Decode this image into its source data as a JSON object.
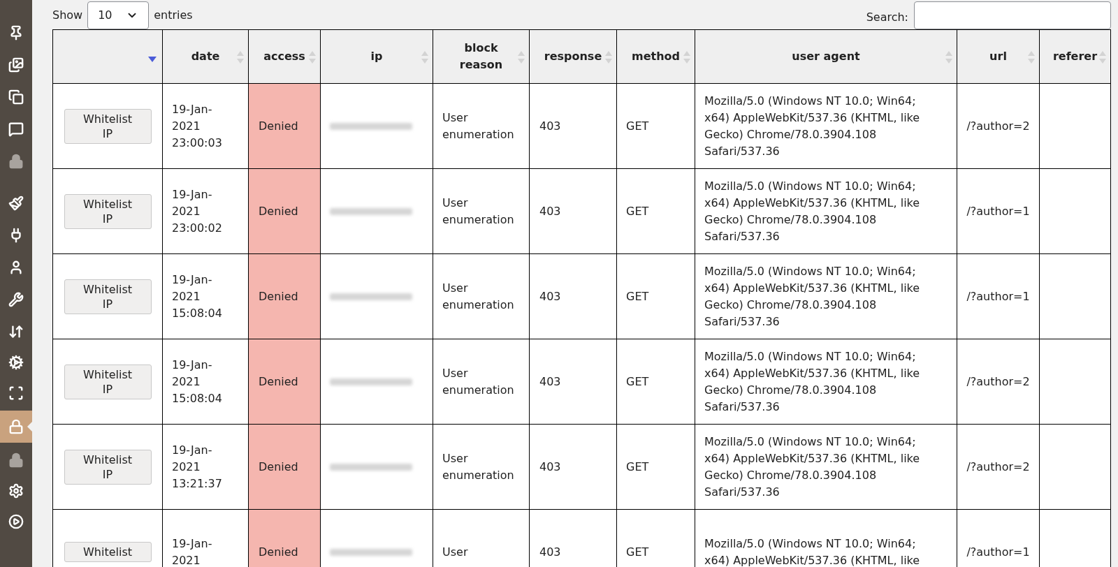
{
  "sidebar": {
    "items": [
      {
        "selected": false,
        "disabled": false
      },
      {
        "selected": false,
        "disabled": false
      },
      {
        "selected": false,
        "disabled": false
      },
      {
        "selected": false,
        "disabled": false
      },
      {
        "selected": false,
        "disabled": true
      },
      {
        "selected": false,
        "disabled": false
      },
      {
        "selected": false,
        "disabled": false
      },
      {
        "selected": false,
        "disabled": false
      },
      {
        "selected": false,
        "disabled": false
      },
      {
        "selected": false,
        "disabled": false
      },
      {
        "selected": false,
        "disabled": false
      },
      {
        "selected": false,
        "disabled": false
      },
      {
        "selected": true,
        "disabled": false
      },
      {
        "selected": false,
        "disabled": true
      },
      {
        "selected": false,
        "disabled": false
      },
      {
        "selected": false,
        "disabled": false
      }
    ]
  },
  "length_menu": {
    "prefix": "Show",
    "value": "10",
    "suffix": "entries"
  },
  "search": {
    "label": "Search:"
  },
  "table": {
    "columns": [
      {
        "sorted": true
      },
      {
        "label": "date",
        "sorted": false
      },
      {
        "label": "access",
        "sorted": false
      },
      {
        "label": "ip",
        "sorted": false
      },
      {
        "label": "block reason",
        "sorted": false
      },
      {
        "label": "response",
        "sorted": false
      },
      {
        "label": "method",
        "sorted": false
      },
      {
        "label": "user agent",
        "sorted": false
      },
      {
        "label": "url",
        "sorted": false
      },
      {
        "label": "referer",
        "sorted": false
      }
    ],
    "rows": [
      {
        "action": "Whitelist IP",
        "date": "19-Jan-2021 23:00:03",
        "access": "Denied",
        "block_reason": "User enumeration",
        "response": "403",
        "method": "GET",
        "user_agent": "Mozilla/5.0 (Windows NT 10.0; Win64; x64) AppleWebKit/537.36 (KHTML, like Gecko) Chrome/78.0.3904.108 Safari/537.36",
        "url": "/?author=2"
      },
      {
        "action": "Whitelist IP",
        "date": "19-Jan-2021 23:00:02",
        "access": "Denied",
        "block_reason": "User enumeration",
        "response": "403",
        "method": "GET",
        "user_agent": "Mozilla/5.0 (Windows NT 10.0; Win64; x64) AppleWebKit/537.36 (KHTML, like Gecko) Chrome/78.0.3904.108 Safari/537.36",
        "url": "/?author=1"
      },
      {
        "action": "Whitelist IP",
        "date": "19-Jan-2021 15:08:04",
        "access": "Denied",
        "block_reason": "User enumeration",
        "response": "403",
        "method": "GET",
        "user_agent": "Mozilla/5.0 (Windows NT 10.0; Win64; x64) AppleWebKit/537.36 (KHTML, like Gecko) Chrome/78.0.3904.108 Safari/537.36",
        "url": "/?author=1"
      },
      {
        "action": "Whitelist IP",
        "date": "19-Jan-2021 15:08:04",
        "access": "Denied",
        "block_reason": "User enumeration",
        "response": "403",
        "method": "GET",
        "user_agent": "Mozilla/5.0 (Windows NT 10.0; Win64; x64) AppleWebKit/537.36 (KHTML, like Gecko) Chrome/78.0.3904.108 Safari/537.36",
        "url": "/?author=2"
      },
      {
        "action": "Whitelist IP",
        "date": "19-Jan-2021 13:21:37",
        "access": "Denied",
        "block_reason": "User enumeration",
        "response": "403",
        "method": "GET",
        "user_agent": "Mozilla/5.0 (Windows NT 10.0; Win64; x64) AppleWebKit/537.36 (KHTML, like Gecko) Chrome/78.0.3904.108 Safari/537.36",
        "url": "/?author=2"
      },
      {
        "action": "Whitelist",
        "date": "19-Jan-2021",
        "access": "Denied",
        "block_reason": "User",
        "response": "403",
        "method": "GET",
        "user_agent": "Mozilla/5.0 (Windows NT 10.0; Win64; x64) AppleWebKit/537.36 (KHTML, like",
        "url": "/?author=1"
      }
    ]
  }
}
